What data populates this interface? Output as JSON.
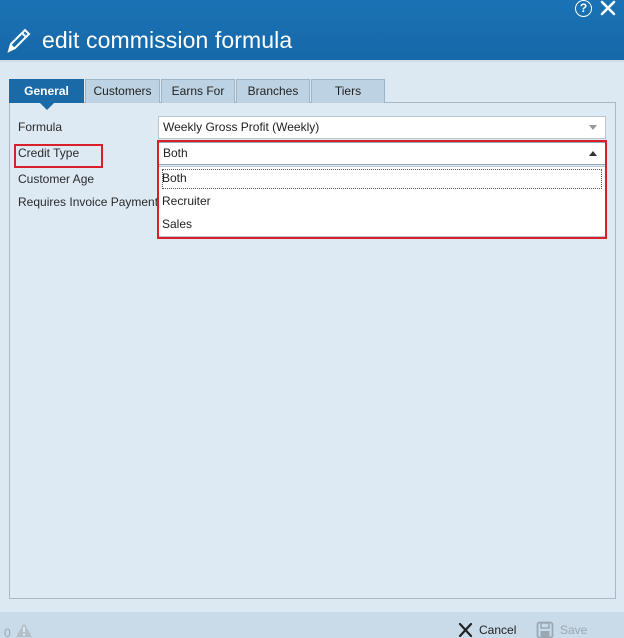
{
  "header": {
    "title": "edit commission formula",
    "help_glyph": "?"
  },
  "tabs": [
    {
      "label": "General",
      "active": true
    },
    {
      "label": "Customers",
      "active": false
    },
    {
      "label": "Earns For",
      "active": false
    },
    {
      "label": "Branches",
      "active": false
    },
    {
      "label": "Tiers",
      "active": false
    }
  ],
  "form": {
    "formula": {
      "label": "Formula",
      "value": "Weekly Gross Profit (Weekly)"
    },
    "credit_type": {
      "label": "Credit Type",
      "value": "Both",
      "options": [
        "Both",
        "Recruiter",
        "Sales"
      ]
    },
    "customer_age": {
      "label": "Customer Age"
    },
    "requires_invoice_payment": {
      "label": "Requires Invoice Payment"
    }
  },
  "footer": {
    "warning_count": "0",
    "cancel_label": "Cancel",
    "save_label": "Save"
  },
  "colors": {
    "header_blue": "#1a73b5",
    "active_tab": "#1a6aa8",
    "highlight_red": "#d9202a",
    "panel_bg": "#dde9f3"
  },
  "icons": [
    "pencil-icon",
    "help-icon",
    "close-icon",
    "dropdown-arrow-icon",
    "warning-icon",
    "cancel-x-icon",
    "save-disk-icon"
  ]
}
